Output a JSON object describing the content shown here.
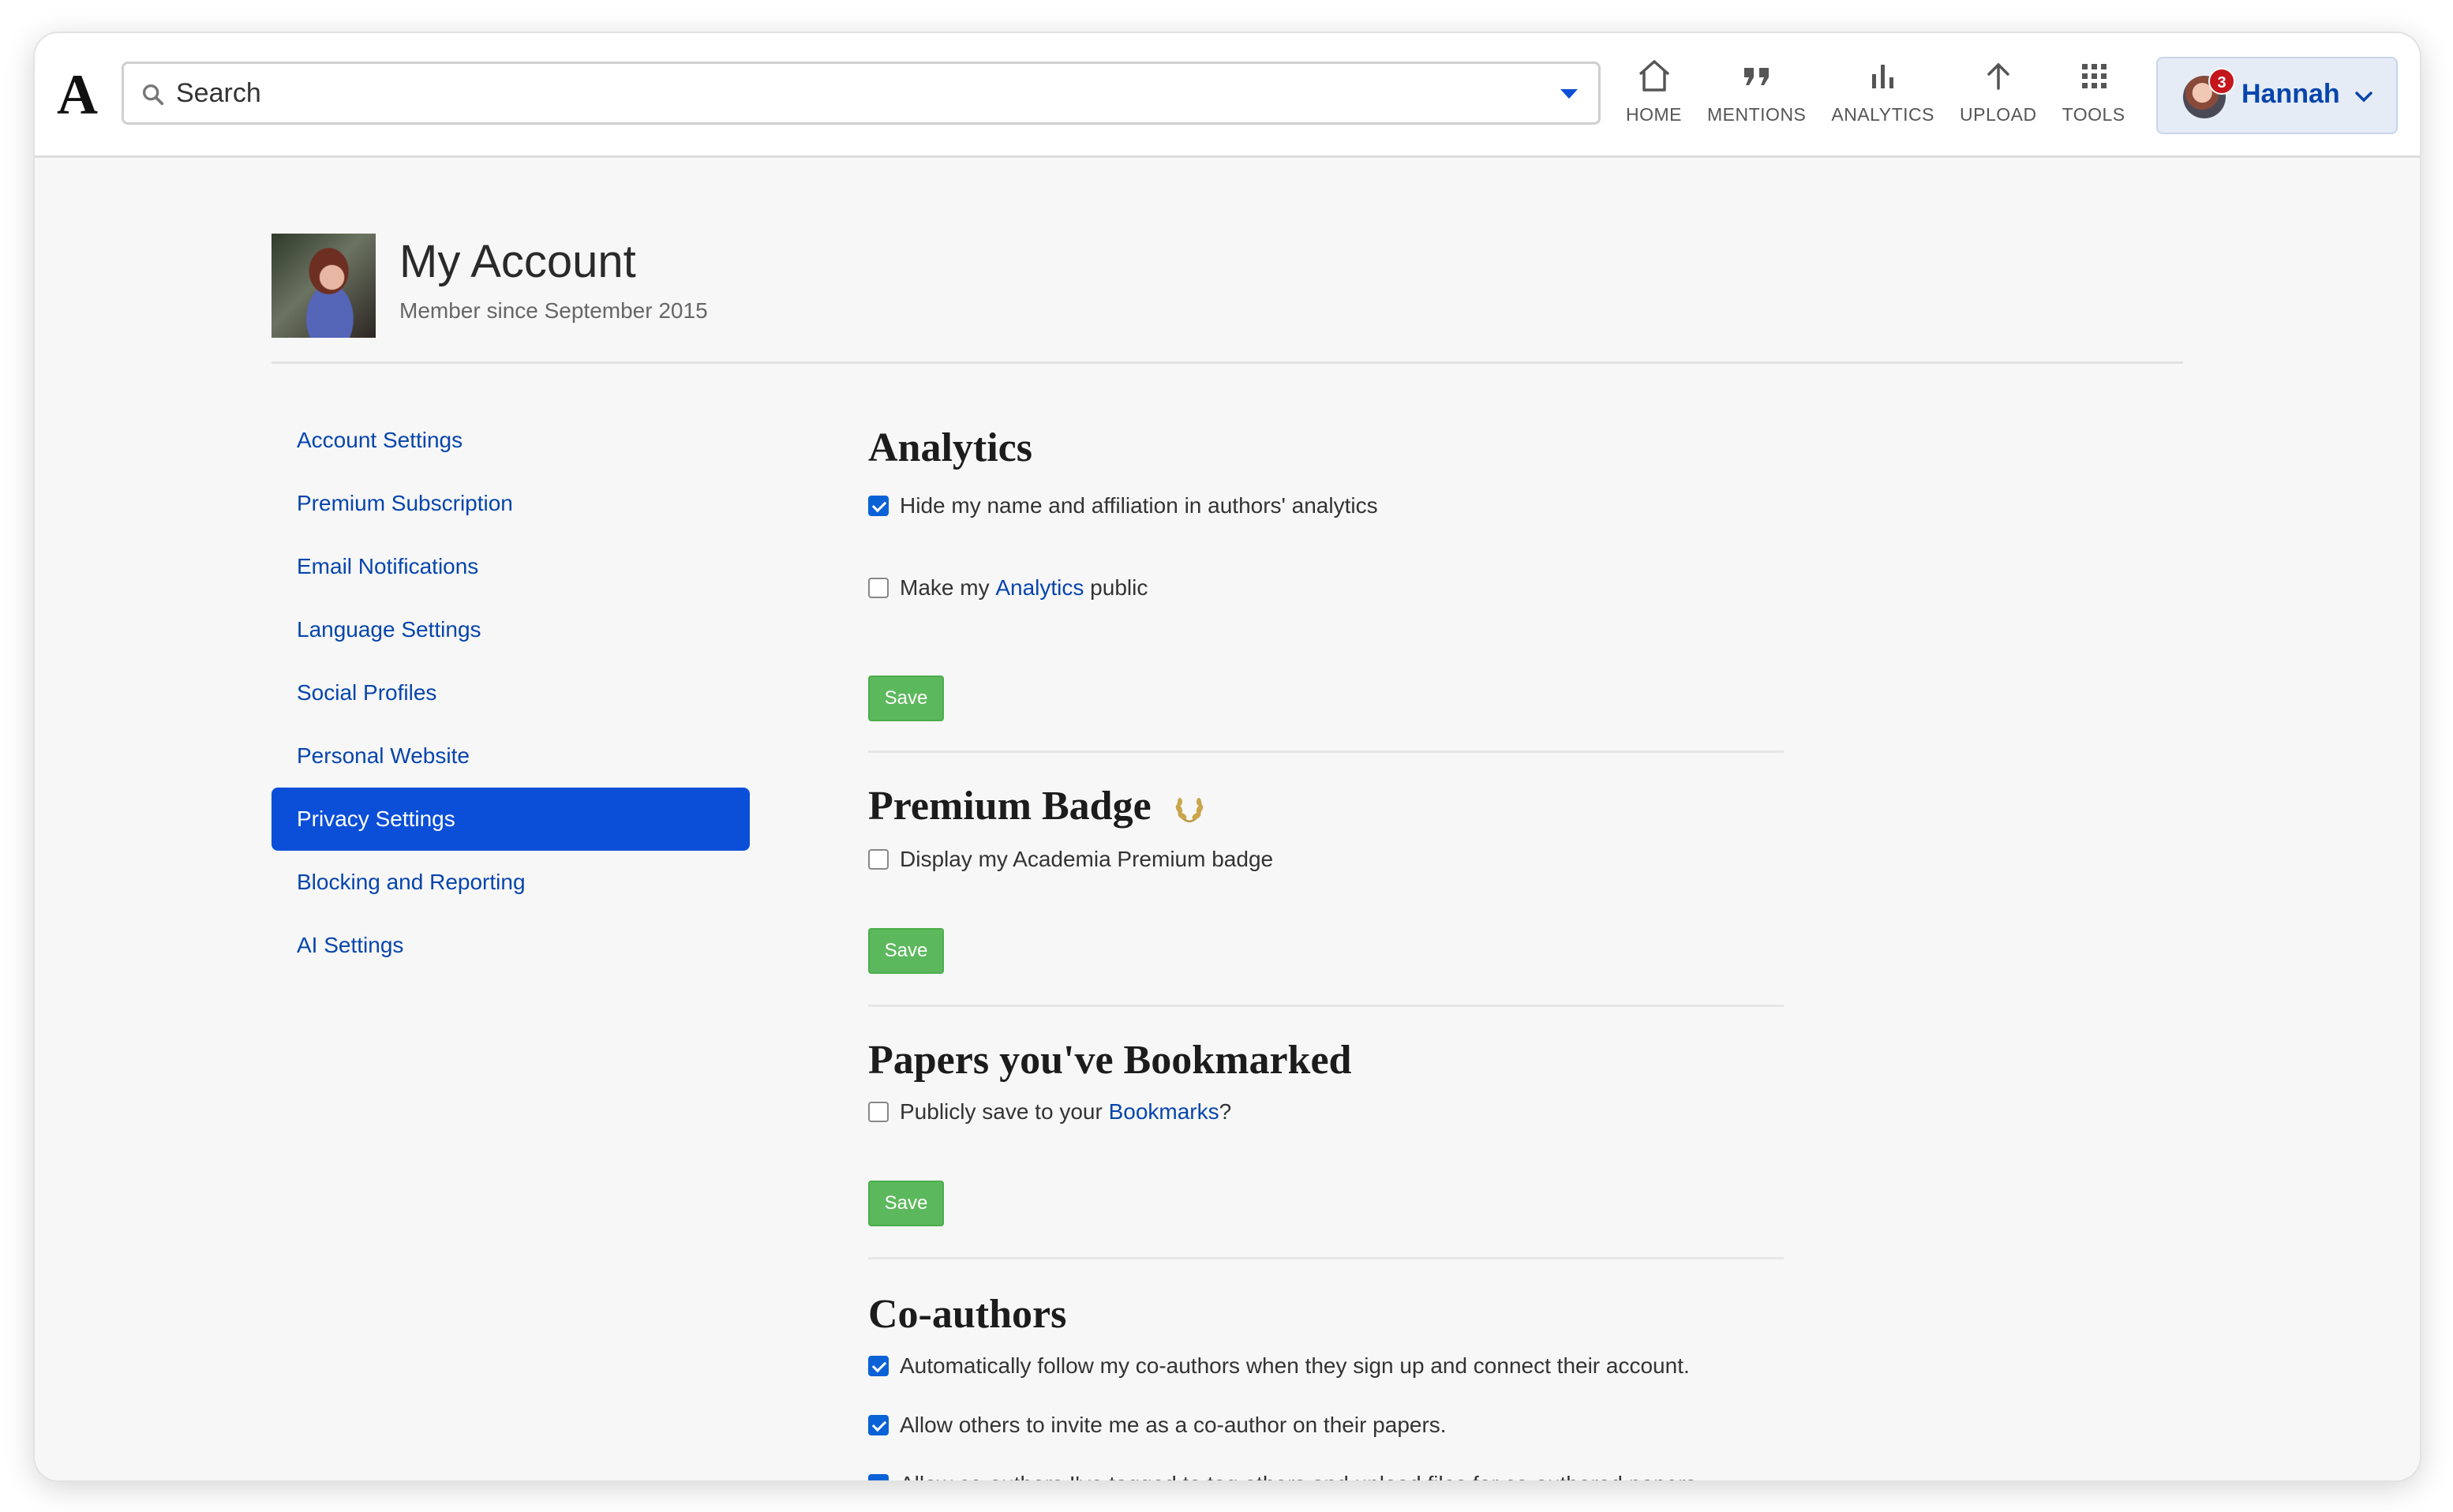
{
  "app": {
    "logo": "A"
  },
  "search": {
    "placeholder": "Search"
  },
  "nav": [
    {
      "label": "HOME",
      "icon": "home-icon"
    },
    {
      "label": "MENTIONS",
      "icon": "quote-icon"
    },
    {
      "label": "ANALYTICS",
      "icon": "bar-chart-icon"
    },
    {
      "label": "UPLOAD",
      "icon": "arrow-up-icon"
    },
    {
      "label": "TOOLS",
      "icon": "grid-icon"
    }
  ],
  "user": {
    "name": "Hannah",
    "notification_count": "3"
  },
  "header": {
    "title": "My Account",
    "member_since": "Member since September 2015"
  },
  "sidebar": {
    "items": [
      {
        "label": "Account Settings"
      },
      {
        "label": "Premium Subscription"
      },
      {
        "label": "Email Notifications"
      },
      {
        "label": "Language Settings"
      },
      {
        "label": "Social Profiles"
      },
      {
        "label": "Personal Website"
      },
      {
        "label": "Privacy Settings",
        "active": true
      },
      {
        "label": "Blocking and Reporting"
      },
      {
        "label": "AI Settings"
      }
    ]
  },
  "sections": {
    "analytics": {
      "title": "Analytics",
      "opt1": {
        "text": "Hide my name and affiliation in authors' analytics",
        "checked": true
      },
      "opt2": {
        "pre": "Make my ",
        "link": "Analytics",
        "post": " public",
        "checked": false
      },
      "save": "Save"
    },
    "premium": {
      "title": "Premium Badge",
      "opt1": {
        "text": "Display my Academia Premium badge",
        "checked": false
      },
      "save": "Save"
    },
    "bookmarks": {
      "title": "Papers you've Bookmarked",
      "opt1": {
        "pre": "Publicly save to your ",
        "link": "Bookmarks",
        "post": "?",
        "checked": false
      },
      "save": "Save"
    },
    "coauthors": {
      "title": "Co-authors",
      "opt1": {
        "text": "Automatically follow my co-authors when they sign up and connect their account.",
        "checked": true
      },
      "opt2": {
        "text": "Allow others to invite me as a co-author on their papers.",
        "checked": true
      },
      "opt3": {
        "text": "Allow co-authors I've tagged to tag others and upload files for co-authored papers.",
        "checked": true
      }
    }
  },
  "colors": {
    "accent": "#0b4fd8",
    "link": "#0645ad",
    "save": "#5cb85c",
    "badge": "#c4161c"
  }
}
